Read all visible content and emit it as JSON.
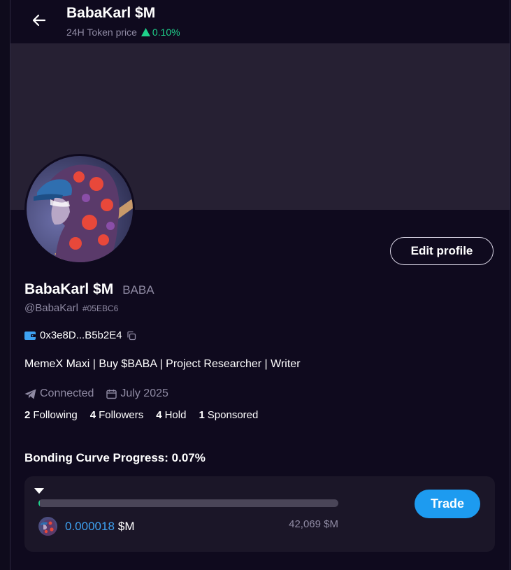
{
  "header": {
    "title": "BabaKarl $M",
    "subtitle_label": "24H Token price",
    "price_change": "0.10%"
  },
  "profile": {
    "edit_label": "Edit profile",
    "display_name": "BabaKarl $M",
    "ticker": "BABA",
    "handle": "@BabaKarl",
    "hash": "#05EBC6",
    "wallet": "0x3e8D...B5b2E4",
    "bio": "MemeX Maxi | Buy $BABA | Project Researcher | Writer",
    "connected": "Connected",
    "joined": "July 2025"
  },
  "stats": [
    {
      "count": "2",
      "label": "Following"
    },
    {
      "count": "4",
      "label": "Followers"
    },
    {
      "count": "4",
      "label": "Hold"
    },
    {
      "count": "1",
      "label": "Sponsored"
    }
  ],
  "bonding": {
    "title": "Bonding Curve Progress: 0.07%",
    "progress_percent": 0.07,
    "price": "0.000018",
    "price_unit": "$M",
    "market_cap": "42,069 $M",
    "trade_label": "Trade"
  },
  "colors": {
    "background": "#0f0a1e",
    "banner": "#262033",
    "accent_blue": "#1d9bf0",
    "positive_green": "#1fd18b",
    "muted_text": "#8f8aa3"
  },
  "icons": {
    "back": "arrow-left-icon",
    "wallet": "wallet-icon",
    "copy": "copy-icon",
    "telegram": "telegram-icon",
    "calendar": "calendar-icon"
  }
}
